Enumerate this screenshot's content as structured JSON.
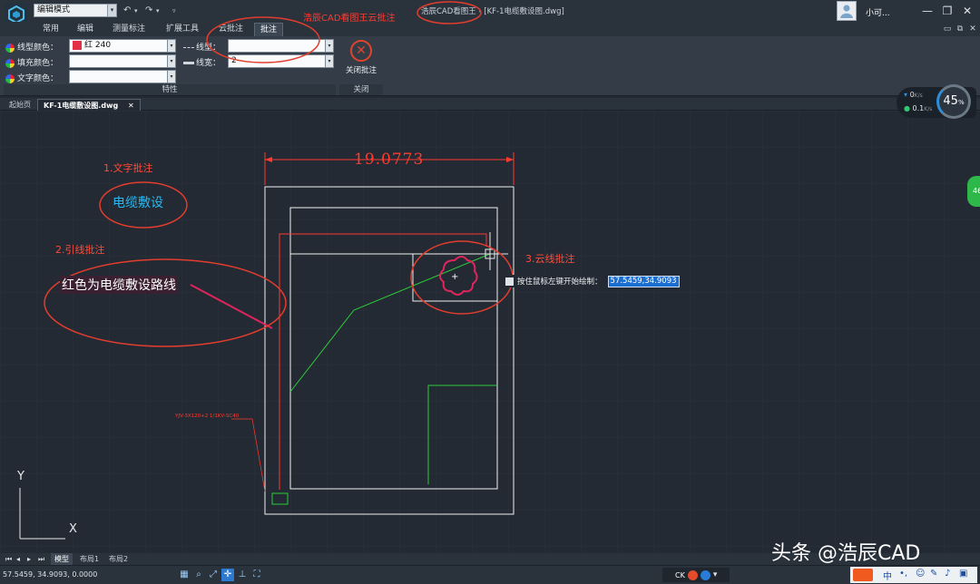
{
  "titlebar": {
    "mode": "编辑模式",
    "window_title": "浩辰CAD看图王 - [KF-1电缆敷设图.dwg]",
    "window_title_prefix": "浩辰CAD看图王",
    "window_title_file": "- [KF-1电缆敷设图.dwg]",
    "user_name": "小可..."
  },
  "ribbon_tabs": [
    "常用",
    "编辑",
    "测量标注",
    "扩展工具",
    "云批注",
    "批注"
  ],
  "active_ribbon_tab": "批注",
  "ribbon": {
    "line_color_label": "线型颜色：",
    "line_color_value": "红 240",
    "fill_color_label": "填充颜色：",
    "fill_color_value": "",
    "text_color_label": "文字颜色：",
    "text_color_value": "",
    "linetype_label": "线型：",
    "linetype_value": "",
    "linewidth_label": "线宽：",
    "linewidth_value": "2",
    "group_properties": "特性",
    "close_annotation_label": "关闭批注",
    "group_close": "关闭",
    "accent_color": "#e23044"
  },
  "doc_tabs": [
    "起始页",
    "KF-1电缆敷设图.dwg"
  ],
  "speed_widget": {
    "down": "0",
    "down_unit": "K/s",
    "up": "0.1",
    "up_unit": "K/s",
    "percent": "45",
    "percent_unit": "%"
  },
  "canvas": {
    "dimension_text": "19.0773",
    "annotation1_label": "1.文字批注",
    "annotation1_text": "电缆敷设",
    "annotation2_label": "2.引线批注",
    "annotation2_text": "红色为电缆敷设路线",
    "annotation3_label": "3.云线批注",
    "overlay_title": "浩辰CAD看图王云批注",
    "tooltip_text": "按住鼠标左键开始绘制：",
    "tooltip_value": "57.5459,34.9093",
    "cable_label": "YJV-3X120+2 1/1KV-SC40",
    "ucs_x": "X",
    "ucs_y": "Y",
    "side_badge": "46"
  },
  "layout_tabs": [
    "模型",
    "布局1",
    "布局2"
  ],
  "status": {
    "coords": "57.5459, 34.9093, 0.0000",
    "ck": "CK"
  },
  "ime": {
    "label": "中"
  },
  "watermark": "头条 @浩辰CAD"
}
